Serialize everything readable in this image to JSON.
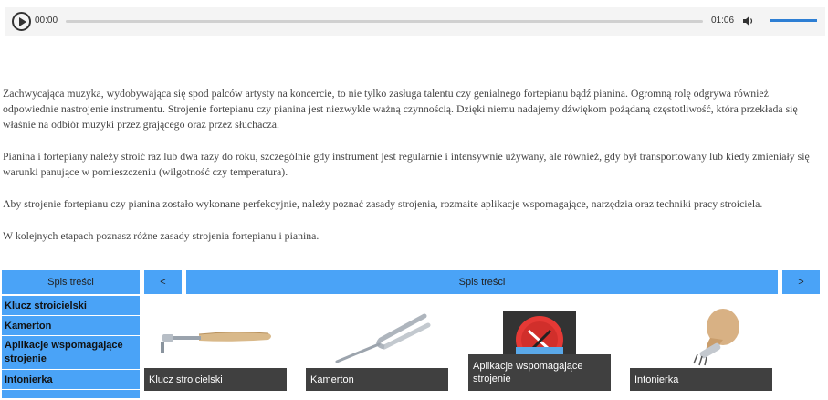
{
  "player": {
    "current_time": "00:00",
    "duration": "01:06",
    "progress": 0,
    "volume": 1.0,
    "icons": [
      "play-icon",
      "volume-icon"
    ]
  },
  "content": {
    "paragraphs": [
      "Zachwycająca muzyka, wydobywająca się spod palców artysty na koncercie, to nie tylko zasługa talentu czy genialnego fortepianu bądź pianina. Ogromną rolę odgrywa również odpowiednie nastrojenie instrumentu. Strojenie fortepianu czy pianina jest niezwykle ważną czynnością. Dzięki niemu nadajemy dźwiękom pożądaną częstotliwość, która przekłada się właśnie na odbiór muzyki przez grającego oraz przez słuchacza.",
      "Pianina i fortepiany należy stroić raz lub dwa razy do roku, szczególnie gdy instrument jest regularnie i intensywnie używany, ale również, gdy był transportowany lub kiedy zmieniały się warunki panujące w pomieszczeniu (wilgotność czy temperatura).",
      "Aby strojenie fortepianu czy pianina zostało wykonane perfekcyjnie, należy poznać zasady strojenia, rozmaite aplikacje wspomagające, narzędzia oraz techniki pracy stroiciela.",
      "W kolejnych etapach poznasz różne zasady strojenia fortepianu i pianina."
    ]
  },
  "toc": {
    "title": "Spis treści",
    "items": [
      {
        "label": "Klucz stroicielski"
      },
      {
        "label": "Kamerton"
      },
      {
        "label": "Aplikacje wspomagające strojenie"
      },
      {
        "label": "Intonierka"
      }
    ]
  },
  "nav": {
    "prev_label": "<",
    "title": "Spis treści",
    "next_label": ">"
  },
  "cards": [
    {
      "caption": "Klucz stroicielski",
      "icon": "tuning-hammer-icon"
    },
    {
      "caption": "Kamerton",
      "icon": "tuning-fork-icon"
    },
    {
      "caption": "Aplikacje wspomagające strojenie",
      "icon": "tuner-app-icon"
    },
    {
      "caption": "Intonierka",
      "icon": "voicing-tool-icon"
    }
  ],
  "colors": {
    "accent": "#4aa3f7",
    "caption_bg": "#404040",
    "volume_fill": "#2e7fd4"
  }
}
